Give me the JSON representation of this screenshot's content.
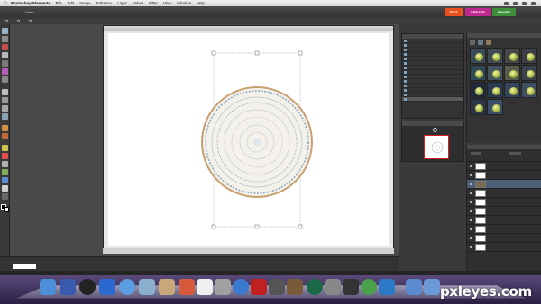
{
  "menubar": {
    "app_name": "Photoshop Elements",
    "items": [
      "File",
      "Edit",
      "Image",
      "Enhance",
      "Layer",
      "Select",
      "Filter",
      "View",
      "Window",
      "Help"
    ]
  },
  "topbar": {
    "undo_label": "Undo",
    "mode_tabs": [
      {
        "label": "EDIT",
        "color": "#e8501c"
      },
      {
        "label": "CREATE",
        "color": "#c0278f"
      },
      {
        "label": "SHARE",
        "color": "#3f8e3a"
      }
    ]
  },
  "optionsbar": {
    "items": [
      "",
      "",
      "",
      "",
      ""
    ]
  },
  "document": {
    "title": "",
    "status_zoom": "",
    "status_size": ""
  },
  "history": {
    "title": "",
    "rows": [
      "",
      "",
      "",
      "",
      "",
      "",
      "",
      "",
      "",
      "",
      "",
      "",
      "",
      ""
    ]
  },
  "navigator": {
    "title": "",
    "zoom": ""
  },
  "effects": {
    "title": ""
  },
  "layers": {
    "title": "",
    "rows": [
      "",
      "",
      "",
      "",
      "",
      "",
      "",
      "",
      "",
      ""
    ]
  },
  "project_bin": {
    "title": "",
    "bottom_label": ""
  },
  "watermark": "pxleyes.com"
}
